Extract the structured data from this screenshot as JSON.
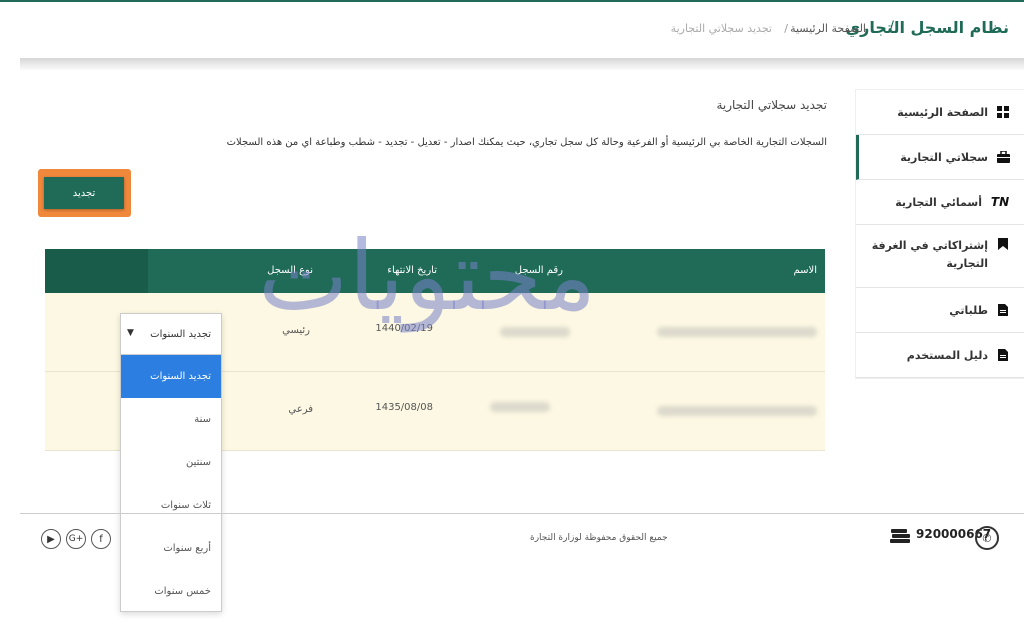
{
  "header": {
    "app_title": "نظام السجل التجاري",
    "separator": "/",
    "breadcrumb_home": "الصفحة الرئيسية",
    "breadcrumb_separator": "/",
    "breadcrumb_current": "تجديد سجلاتي التجارية"
  },
  "sidebar": {
    "items": [
      {
        "label": "الصفحة الرئيسية",
        "icon": "grid-icon"
      },
      {
        "label": "سجلاتي التجارية",
        "icon": "briefcase-icon"
      },
      {
        "label": "أسمائي التجارية",
        "icon": "tn-icon"
      },
      {
        "label": "إشتراكاتي في الغرفة التجارية",
        "icon": "bookmark-icon"
      },
      {
        "label": "طلباتي",
        "icon": "document-icon"
      },
      {
        "label": "دليل المستخدم",
        "icon": "document-icon"
      }
    ],
    "tn_glyph": "TN"
  },
  "main": {
    "title": "تجديد سجلاتي التجارية",
    "description": "السجلات التجارية الخاصة بي الرئيسية أو الفرعية وحالة كل سجل تجاري، حيث يمكنك اصدار - تعديل - تجديد - شطب وطباعة اي من هذه السجلات",
    "renew_button": "تجديد"
  },
  "table": {
    "headers": {
      "name": "الاسم",
      "record_number": "رقم السجل",
      "expiry_date": "تاريخ الانتهاء",
      "record_type": "نوع السجل"
    },
    "rows": [
      {
        "expiry_date": "1440/02/19",
        "record_type": "رئيسي"
      },
      {
        "expiry_date": "1435/08/08",
        "record_type": "فرعي"
      }
    ]
  },
  "dropdown": {
    "selected": "تجديد السنوات",
    "caret": "▼",
    "options": [
      "تجديد السنوات",
      "سنة",
      "سنتين",
      "ثلاث سنوات",
      "أربع سنوات",
      "خمس سنوات"
    ]
  },
  "watermark": "محتويات",
  "footer": {
    "copyright": "جميع الحقوق محفوظة لوزارة التجارة",
    "phone": "920000667",
    "social": [
      "play-icon",
      "google-plus-icon",
      "facebook-icon"
    ],
    "social_glyphs": [
      "▶",
      "G+",
      "f"
    ]
  },
  "colors": {
    "primary": "#1f6b57",
    "highlight": "#2c7fe0",
    "callout": "#f0883c",
    "row_bg": "#fcf8e3"
  }
}
